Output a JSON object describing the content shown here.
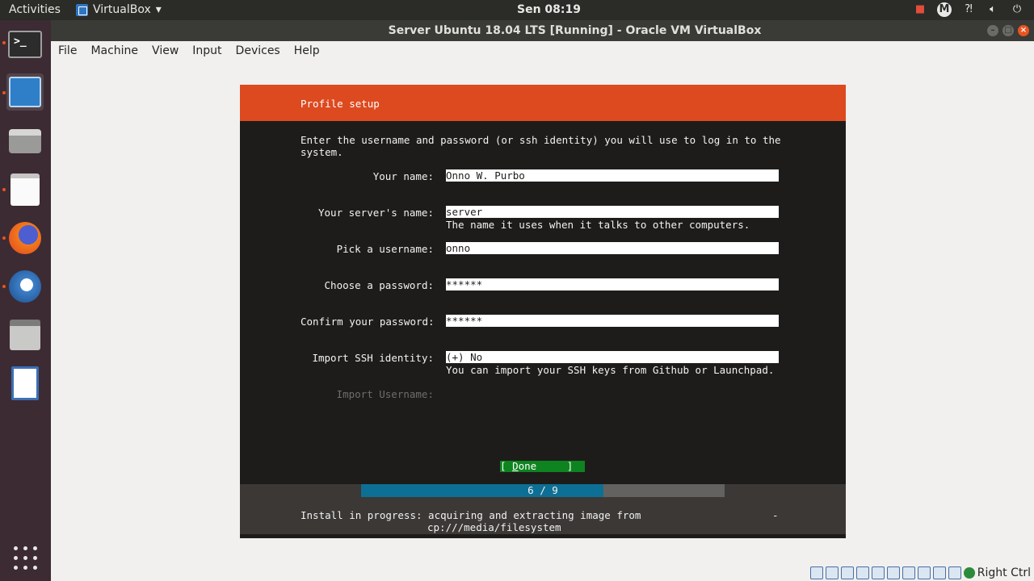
{
  "topbar": {
    "activities": "Activities",
    "app_name": "VirtualBox",
    "app_arrow": "▾",
    "clock": "Sen 08:19",
    "tray_icons": [
      "record-icon",
      "m-user-icon",
      "accessibility-icon",
      "volume-icon",
      "power-icon"
    ]
  },
  "window": {
    "title": "Server Ubuntu 18.04 LTS [Running] - Oracle VM VirtualBox"
  },
  "menu": {
    "items": [
      "File",
      "Machine",
      "View",
      "Input",
      "Devices",
      "Help"
    ]
  },
  "dock": {
    "apps": [
      "terminal",
      "system-monitor",
      "scanner",
      "text-editor",
      "firefox",
      "thunderbird",
      "files",
      "writer",
      "show-applications"
    ]
  },
  "installer": {
    "header": "Profile setup",
    "intro_line1": "Enter the username and password (or ssh identity) you will use to log in to the",
    "intro_line2": "system.",
    "fields": [
      {
        "label": "Your name:",
        "value": "Onno W. Purbo"
      },
      {
        "label": "Your server's name:",
        "value": "server",
        "hint": "The name it uses when it talks to other computers."
      },
      {
        "label": "Pick a username:",
        "value": "onno"
      },
      {
        "label": "Choose a password:",
        "value": "******"
      },
      {
        "label": "Confirm your password:",
        "value": "******"
      },
      {
        "label": "Import SSH identity:",
        "value": "(+) No",
        "hint": "You can import your SSH keys from Github or Launchpad."
      },
      {
        "label": "Import Username:",
        "value": ""
      }
    ],
    "done_prefix": "[ ",
    "done_u": "D",
    "done_rest": "one",
    "done_suffix": "     ]",
    "progress_label": "6 / 9",
    "progress_fraction": 0.6667,
    "status_line1": "Install in progress: acquiring and extracting image from",
    "status_line2": "cp:///media/filesystem",
    "spinner": "-"
  },
  "vm_status": {
    "host_key": "Right Ctrl"
  },
  "colors": {
    "ubuntu_orange": "#dd4a1f",
    "done_green": "#0e8420",
    "progress_blue": "#0e6f94",
    "console_bg": "#1e1c1a"
  }
}
